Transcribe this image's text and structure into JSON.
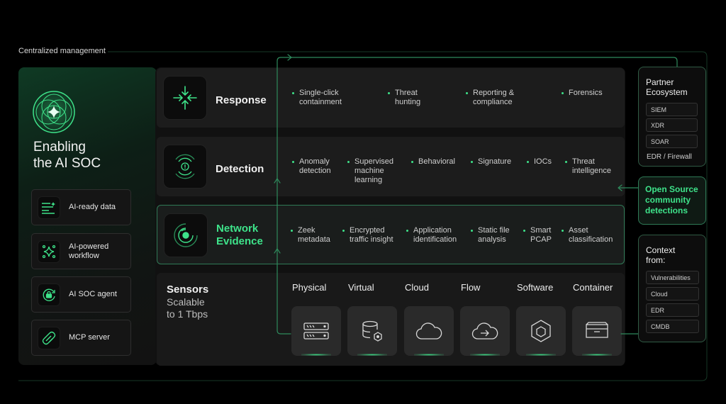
{
  "header": {
    "centralized_label": "Centralized management"
  },
  "hero": {
    "title_line1": "Enabling",
    "title_line2": "the AI SOC"
  },
  "left_items": [
    {
      "label": "AI-ready data",
      "icon": "data-lines-icon"
    },
    {
      "label": "AI-powered workflow",
      "icon": "sparkle-network-icon"
    },
    {
      "label": "AI SOC agent",
      "icon": "lock-cycle-icon"
    },
    {
      "label": "MCP server",
      "icon": "link-chain-icon"
    }
  ],
  "rows": {
    "response": {
      "title": "Response",
      "items": [
        "Single-click containment",
        "Threat hunting",
        "Reporting & compliance",
        "Forensics"
      ]
    },
    "detection": {
      "title": "Detection",
      "items": [
        "Anomaly detection",
        "Supervised machine learning",
        "Behavioral",
        "Signature",
        "IOCs",
        "Threat intelligence"
      ]
    },
    "network": {
      "title_line1": "Network",
      "title_line2": "Evidence",
      "items": [
        "Zeek metadata",
        "Encrypted traffic insight",
        "Application identification",
        "Static file analysis",
        "Smart PCAP",
        "Asset classification"
      ]
    }
  },
  "sensors": {
    "title": "Sensors",
    "subtitle_line1": "Scalable",
    "subtitle_line2": "to 1 Tbps",
    "items": [
      {
        "label": "Physical",
        "icon": "server-rack-icon"
      },
      {
        "label": "Virtual",
        "icon": "database-hex-icon"
      },
      {
        "label": "Cloud",
        "icon": "cloud-icon"
      },
      {
        "label": "Flow",
        "icon": "cloud-arrow-icon"
      },
      {
        "label": "Software",
        "icon": "hexagon-cube-icon"
      },
      {
        "label": "Container",
        "icon": "container-box-icon"
      }
    ]
  },
  "partner": {
    "title_line1": "Partner",
    "title_line2": "Ecosystem",
    "items": [
      "SIEM",
      "XDR",
      "SOAR"
    ],
    "footer": "EDR / Firewall"
  },
  "open_source": {
    "line1": "Open Source",
    "line2": "community",
    "line3": "detections"
  },
  "context": {
    "title_line1": "Context",
    "title_line2": "from:",
    "items": [
      "Vulnerabilities",
      "Cloud",
      "EDR",
      "CMDB"
    ]
  },
  "colors": {
    "accent": "#3ee38a",
    "border_green": "#2f7a56",
    "panel": "#1c1c1c"
  }
}
